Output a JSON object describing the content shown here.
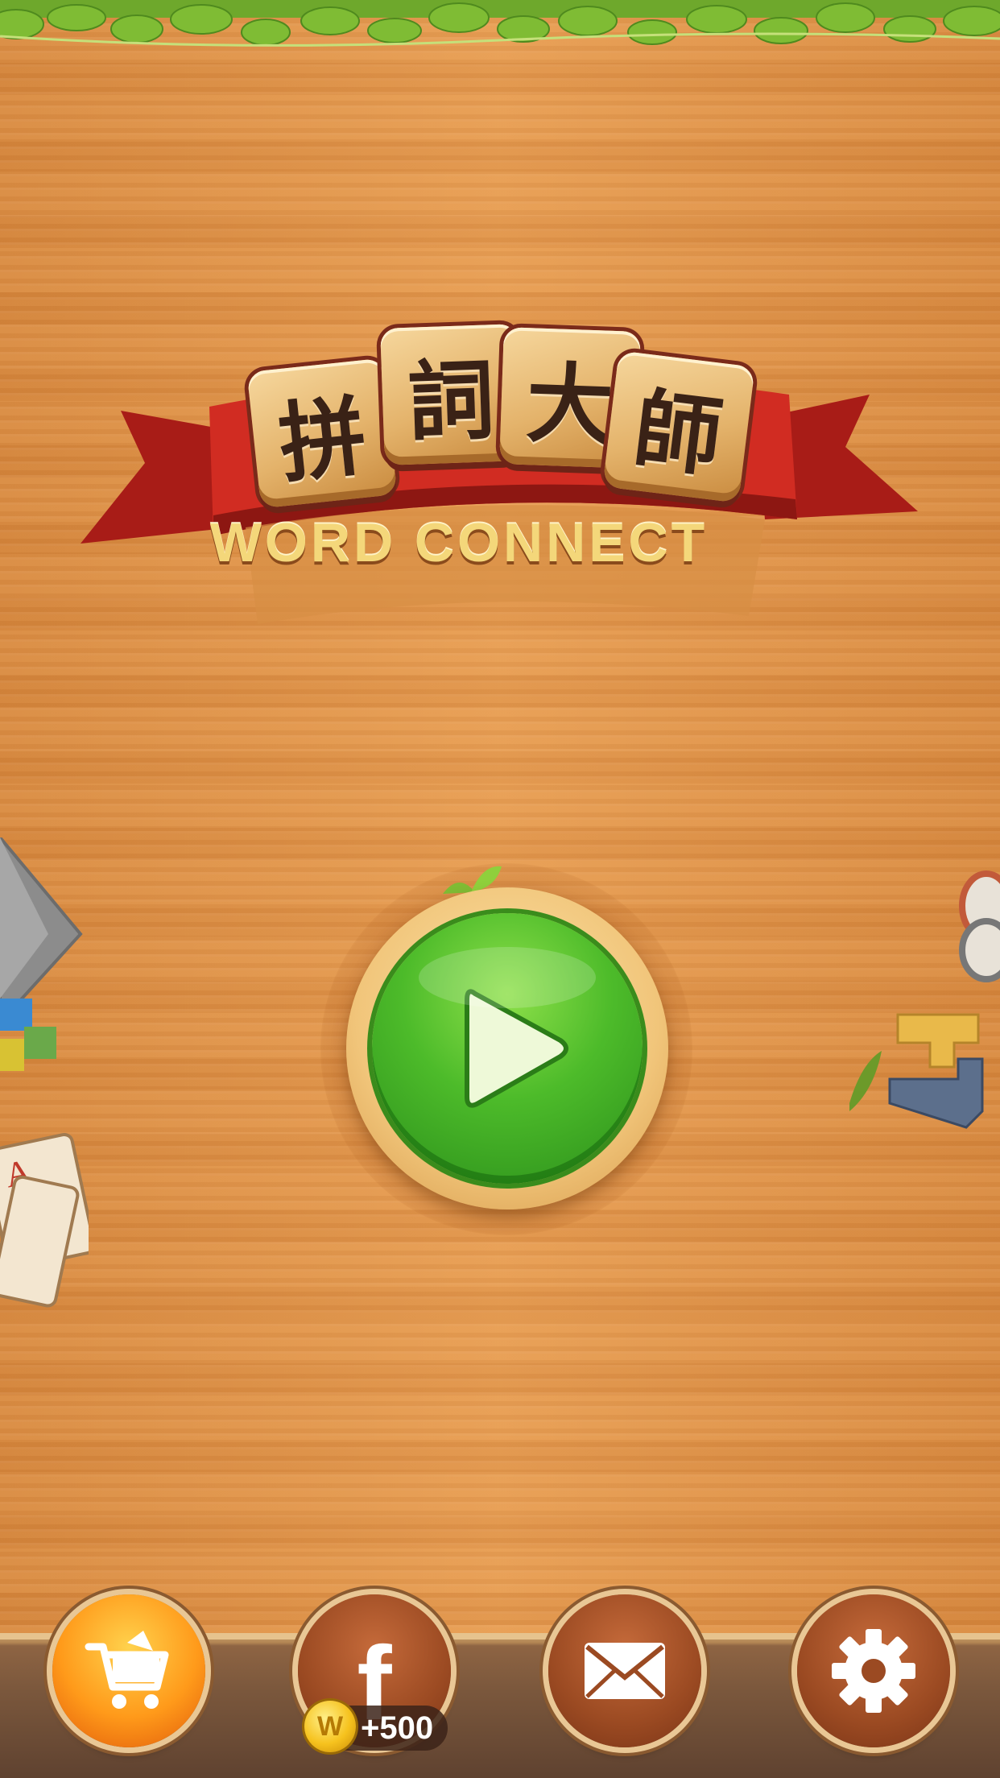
{
  "logo": {
    "tiles": [
      "拼",
      "詞",
      "大",
      "師"
    ],
    "subtitle": "WORD CONNECT"
  },
  "play_button": {
    "icon": "play-icon"
  },
  "bottom_menu": {
    "shop": {
      "icon": "shopping-cart-icon"
    },
    "facebook": {
      "icon": "facebook-icon",
      "glyph": "f",
      "reward": "+500",
      "coin_letter": "W"
    },
    "mail": {
      "icon": "envelope-icon"
    },
    "settings": {
      "icon": "gear-icon"
    }
  },
  "colors": {
    "wood": "#e29548",
    "ribbon": "#c8261f",
    "play_green": "#4dbb2a",
    "shop_orange": "#ff9a1a",
    "button_brown": "#9b4a22"
  }
}
